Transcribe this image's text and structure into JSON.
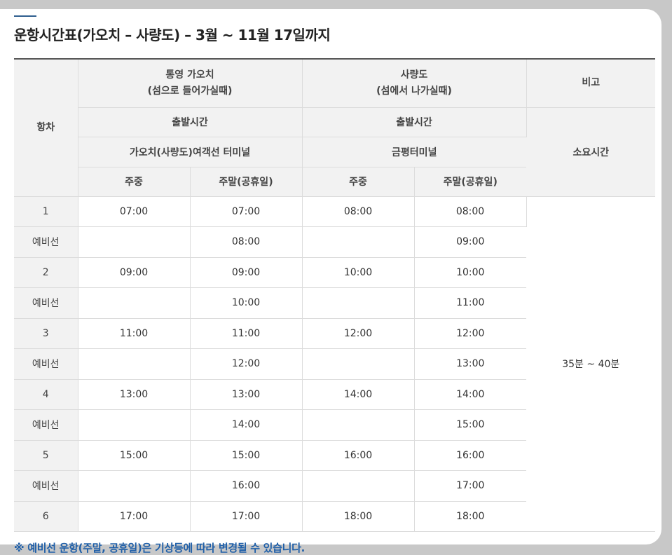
{
  "title": "운항시간표(가오치 – 사량도) – 3월 ~ 11월 17일까지",
  "header": {
    "trip": "항차",
    "origin_name": "통영 가오치",
    "origin_sub": "(섬으로 들어가실때)",
    "dest_name": "사량도",
    "dest_sub": "(섬에서 나가실때)",
    "remarks": "비고",
    "depart_time_left": "출발시간",
    "depart_time_right": "출발시간",
    "terminal_left": "가오치(사량도)여객선 터미널",
    "terminal_right": "금평터미널",
    "duration_label": "소요시간",
    "weekday_left": "주중",
    "weekend_left": "주말(공휴일)",
    "weekday_right": "주중",
    "weekend_right": "주말(공휴일)"
  },
  "rows": [
    {
      "trip": "1",
      "a_weekday": "07:00",
      "a_weekend": "07:00",
      "b_weekday": "08:00",
      "b_weekend": "08:00"
    },
    {
      "trip": "예비선",
      "a_weekday": "",
      "a_weekend": "08:00",
      "b_weekday": "",
      "b_weekend": "09:00"
    },
    {
      "trip": "2",
      "a_weekday": "09:00",
      "a_weekend": "09:00",
      "b_weekday": "10:00",
      "b_weekend": "10:00"
    },
    {
      "trip": "예비선",
      "a_weekday": "",
      "a_weekend": "10:00",
      "b_weekday": "",
      "b_weekend": "11:00"
    },
    {
      "trip": "3",
      "a_weekday": "11:00",
      "a_weekend": "11:00",
      "b_weekday": "12:00",
      "b_weekend": "12:00"
    },
    {
      "trip": "예비선",
      "a_weekday": "",
      "a_weekend": "12:00",
      "b_weekday": "",
      "b_weekend": "13:00"
    },
    {
      "trip": "4",
      "a_weekday": "13:00",
      "a_weekend": "13:00",
      "b_weekday": "14:00",
      "b_weekend": "14:00"
    },
    {
      "trip": "예비선",
      "a_weekday": "",
      "a_weekend": "14:00",
      "b_weekday": "",
      "b_weekend": "15:00"
    },
    {
      "trip": "5",
      "a_weekday": "15:00",
      "a_weekend": "15:00",
      "b_weekday": "16:00",
      "b_weekend": "16:00"
    },
    {
      "trip": "예비선",
      "a_weekday": "",
      "a_weekend": "16:00",
      "b_weekday": "",
      "b_weekend": "17:00"
    },
    {
      "trip": "6",
      "a_weekday": "17:00",
      "a_weekend": "17:00",
      "b_weekday": "18:00",
      "b_weekend": "18:00"
    }
  ],
  "duration_value": "35분 ~ 40분",
  "footnote": "※ 예비선 운항(주말, 공휴일)은 기상등에 따라 변경될 수 있습니다."
}
